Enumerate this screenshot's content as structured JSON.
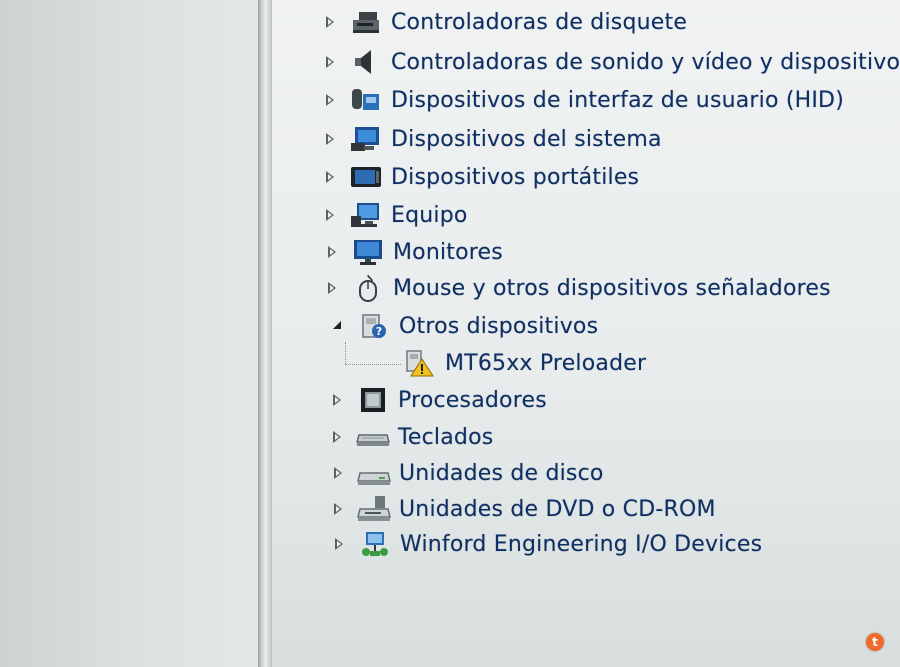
{
  "device_manager": {
    "categories": [
      {
        "label": "Controladoras de disquete",
        "icon": "floppy-controller-icon",
        "expanded": false
      },
      {
        "label": "Controladoras de sonido y vídeo y dispositivos",
        "icon": "speaker-icon",
        "expanded": false
      },
      {
        "label": "Dispositivos de interfaz de usuario (HID)",
        "icon": "hid-device-icon",
        "expanded": false
      },
      {
        "label": "Dispositivos del sistema",
        "icon": "system-device-icon",
        "expanded": false
      },
      {
        "label": "Dispositivos portátiles",
        "icon": "portable-device-icon",
        "expanded": false
      },
      {
        "label": "Equipo",
        "icon": "computer-icon",
        "expanded": false
      },
      {
        "label": "Monitores",
        "icon": "monitor-icon",
        "expanded": false
      },
      {
        "label": "Mouse y otros dispositivos señaladores",
        "icon": "mouse-icon",
        "expanded": false
      },
      {
        "label": "Otros dispositivos",
        "icon": "unknown-device-icon",
        "expanded": true
      },
      {
        "label": "MT65xx Preloader",
        "icon": "warning-device-icon",
        "expanded": false,
        "child": true
      },
      {
        "label": "Procesadores",
        "icon": "processor-icon",
        "expanded": false
      },
      {
        "label": "Teclados",
        "icon": "keyboard-icon",
        "expanded": false
      },
      {
        "label": "Unidades de disco",
        "icon": "disk-drive-icon",
        "expanded": false
      },
      {
        "label": "Unidades de DVD o CD-ROM",
        "icon": "dvd-drive-icon",
        "expanded": false
      },
      {
        "label": "Winford Engineering I/O Devices",
        "icon": "network-device-icon",
        "expanded": false
      }
    ]
  },
  "colors": {
    "label": "#0f2f63",
    "background": "#e8ecec",
    "watermark": "#f06a2b"
  },
  "watermark": {
    "icon": "tumblr-logo-icon"
  }
}
